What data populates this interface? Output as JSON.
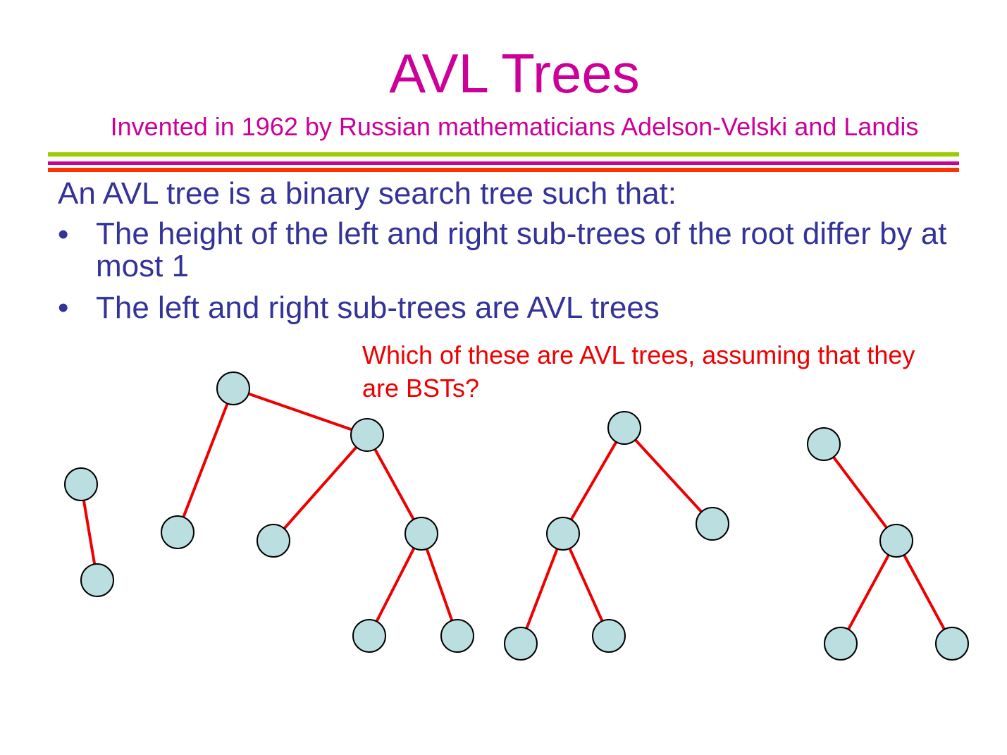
{
  "slide": {
    "title": "AVL Trees",
    "subtitle": "Invented in 1962 by Russian mathematicians Adelson-Velski and Landis",
    "intro": "An AVL tree is a binary search tree such that:",
    "bullets": [
      {
        "marker": "•",
        "text": "The height of the left and right sub-trees of the root differ by at most 1"
      },
      {
        "marker": "•",
        "text": "The left and right sub-trees are AVL trees"
      }
    ],
    "question": "Which of these are AVL trees, assuming that they are BSTs?"
  },
  "colors": {
    "title": "#CC0099",
    "body_text": "#333399",
    "question": "#EE0000",
    "edge": "#EE0000",
    "node_fill": "#BBDFE0",
    "node_stroke": "#000000",
    "rule_green": "#99CC00",
    "rule_magenta": "#CC0099",
    "rule_orange": "#FF3300"
  },
  "trees": [
    {
      "name": "tree-1",
      "nodes": 2
    },
    {
      "name": "tree-2",
      "nodes": 7
    },
    {
      "name": "tree-3",
      "nodes": 5
    },
    {
      "name": "tree-4",
      "nodes": 4
    }
  ]
}
